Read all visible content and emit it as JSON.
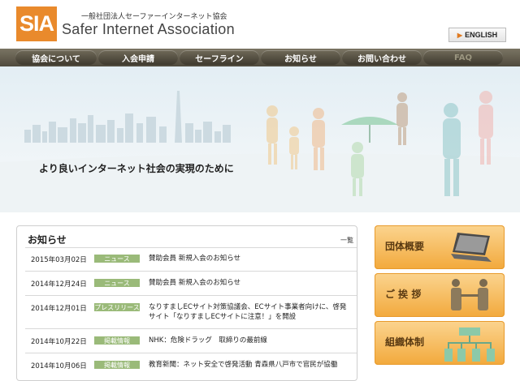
{
  "header": {
    "logo_text": "SIA",
    "org_name_jp": "一般社団法人セーファーインターネット協会",
    "org_name_en": "Safer Internet Association",
    "english_button": "ENGLISH"
  },
  "nav": {
    "items": [
      {
        "label": "協会について"
      },
      {
        "label": "入会申請"
      },
      {
        "label": "セーフライン"
      },
      {
        "label": "お知らせ"
      },
      {
        "label": "お問い合わせ"
      },
      {
        "label": "FAQ"
      }
    ]
  },
  "hero": {
    "tagline": "より良いインターネット社会の実現のために"
  },
  "news": {
    "title": "お知らせ",
    "list_link": "一覧",
    "items": [
      {
        "date": "2015年03月02日",
        "category": "ニュース",
        "text": "賛助会員 新規入会のお知らせ"
      },
      {
        "date": "2014年12月24日",
        "category": "ニュース",
        "text": "賛助会員 新規入会のお知らせ"
      },
      {
        "date": "2014年12月01日",
        "category": "プレスリリース",
        "text": "なりすましECサイト対策協議会、ECサイト事業者向けに、啓発サイト「なりすましECサイトに注意！」を開設"
      },
      {
        "date": "2014年10月22日",
        "category": "掲載情報",
        "text": "NHK：危険ドラッグ　取締りの最前線"
      },
      {
        "date": "2014年10月06日",
        "category": "掲載情報",
        "text": "教育新聞：ネット安全で啓発活動 青森県八戸市で官民が協働"
      }
    ]
  },
  "sidebar": {
    "items": [
      {
        "label": "団体概要"
      },
      {
        "label": "ご 挨 拶"
      },
      {
        "label": "組織体制"
      }
    ]
  },
  "colors": {
    "accent": "#e98a2c",
    "nav_bg": "#5a5546",
    "category_badge": "#9aba79",
    "side_button": "#f6b24c"
  }
}
